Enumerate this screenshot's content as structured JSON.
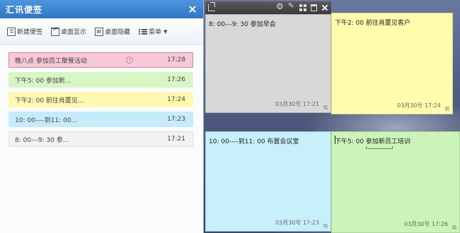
{
  "panel": {
    "title": "汇讯便签",
    "toolbar": {
      "new_label": "新建便签",
      "show_label": "桌面显示",
      "hide_label": "桌面隐藏",
      "menu_label": "菜单"
    },
    "items": [
      {
        "text": "晚八点  参加员工聚餐活动",
        "time": "17:28",
        "has_alarm": true,
        "color": "#f6c8d8"
      },
      {
        "text": "下午5: 00   参加新...",
        "time": "17:26",
        "color": "#d8f6c4"
      },
      {
        "text": "下午2: 00   前往肖厦见...",
        "time": "17:24",
        "color": "#fff9b0"
      },
      {
        "text": "10: 00----到11: 00...",
        "time": "17:23",
        "color": "#c6ecfb"
      },
      {
        "text": "8: 00---9: 30  参...",
        "time": "17:21",
        "color": "#f2f2f2"
      }
    ]
  },
  "notes": [
    {
      "text": "8: 00---9: 30  参加早会",
      "date": "03月30号 17:21",
      "color": "#d8d8d8"
    },
    {
      "text": "下午2: 00   前往肖厦见客户",
      "date": "03月30号 17:24",
      "color": "#fffcad"
    },
    {
      "text": "10: 00----到11: 00  布置会议室",
      "date": "03月30号 17:23",
      "color": "#c8f0fb"
    },
    {
      "text": "下午5: 00   参加新员工培训",
      "date": "03月30号 17:26",
      "color": "#ccf3b8"
    }
  ],
  "icons": {
    "titlebar": [
      "back-icon",
      "gear-icon",
      "pin-icon",
      "grid-icon",
      "trash-icon",
      "close-icon"
    ],
    "toolbar": [
      "new-note-icon",
      "show-desktop-icon",
      "hide-desktop-icon",
      "menu-icon"
    ]
  }
}
